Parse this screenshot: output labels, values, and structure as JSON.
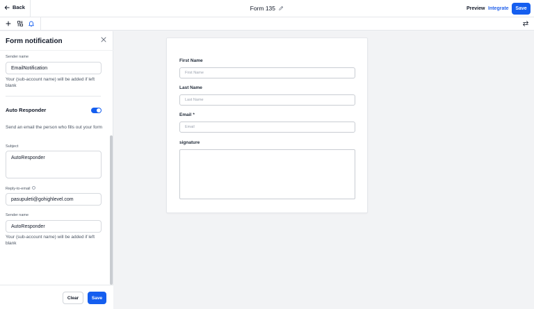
{
  "topbar": {
    "back_label": "Back",
    "form_title": "Form 135",
    "preview_label": "Preview",
    "integrate_label": "Integrate",
    "save_label": "Save"
  },
  "toolbar": {
    "icons": [
      "plus-icon",
      "layout-icon",
      "bell-icon",
      "swap-icon"
    ]
  },
  "panel": {
    "title": "Form notification",
    "sender_name_1": {
      "label": "Sender name",
      "value": "EmailNotification",
      "help": "Your (sub-account name) will be added if left blank"
    },
    "auto_responder": {
      "title": "Auto Responder",
      "enabled": true,
      "description": "Send an email the person who fills out your form"
    },
    "subject": {
      "label": "Subject",
      "value": "AutoResponder"
    },
    "reply_to": {
      "label": "Reply-to-email",
      "value": "pasupuleti@gohighlevel.com"
    },
    "sender_name_2": {
      "label": "Sender name",
      "value": "AutoResponder",
      "help": "Your (sub-account name) will be added if left blank"
    },
    "footer": {
      "clear_label": "Clear",
      "save_label": "Save"
    }
  },
  "form": {
    "first_name": {
      "label": "First Name",
      "placeholder": "First Name"
    },
    "last_name": {
      "label": "Last Name",
      "placeholder": "Last Name"
    },
    "email": {
      "label": "Email",
      "required_mark": "*",
      "placeholder": "Email"
    },
    "signature": {
      "label": "signature"
    }
  },
  "colors": {
    "accent": "#155eef",
    "link": "#2563eb",
    "canvas_bg": "#f2f3f5"
  }
}
